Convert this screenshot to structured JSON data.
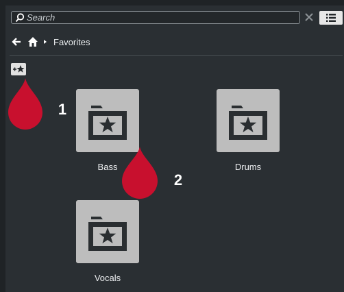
{
  "search": {
    "placeholder": "Search"
  },
  "breadcrumb": {
    "current": "Favorites"
  },
  "folders": [
    {
      "label": "Bass"
    },
    {
      "label": "Drums"
    },
    {
      "label": "Vocals"
    }
  ],
  "callouts": [
    {
      "number": "1"
    },
    {
      "number": "2"
    }
  ],
  "colors": {
    "background": "#2a2f33",
    "tile": "#bdbdbd",
    "callout": "#c8102e",
    "accent": "#e7e7e7"
  },
  "icons": [
    "search-icon",
    "clear-icon",
    "list-view-icon",
    "back-arrow-icon",
    "home-icon",
    "chevron-right-icon",
    "add-favorite-icon",
    "folder-star-icon"
  ]
}
